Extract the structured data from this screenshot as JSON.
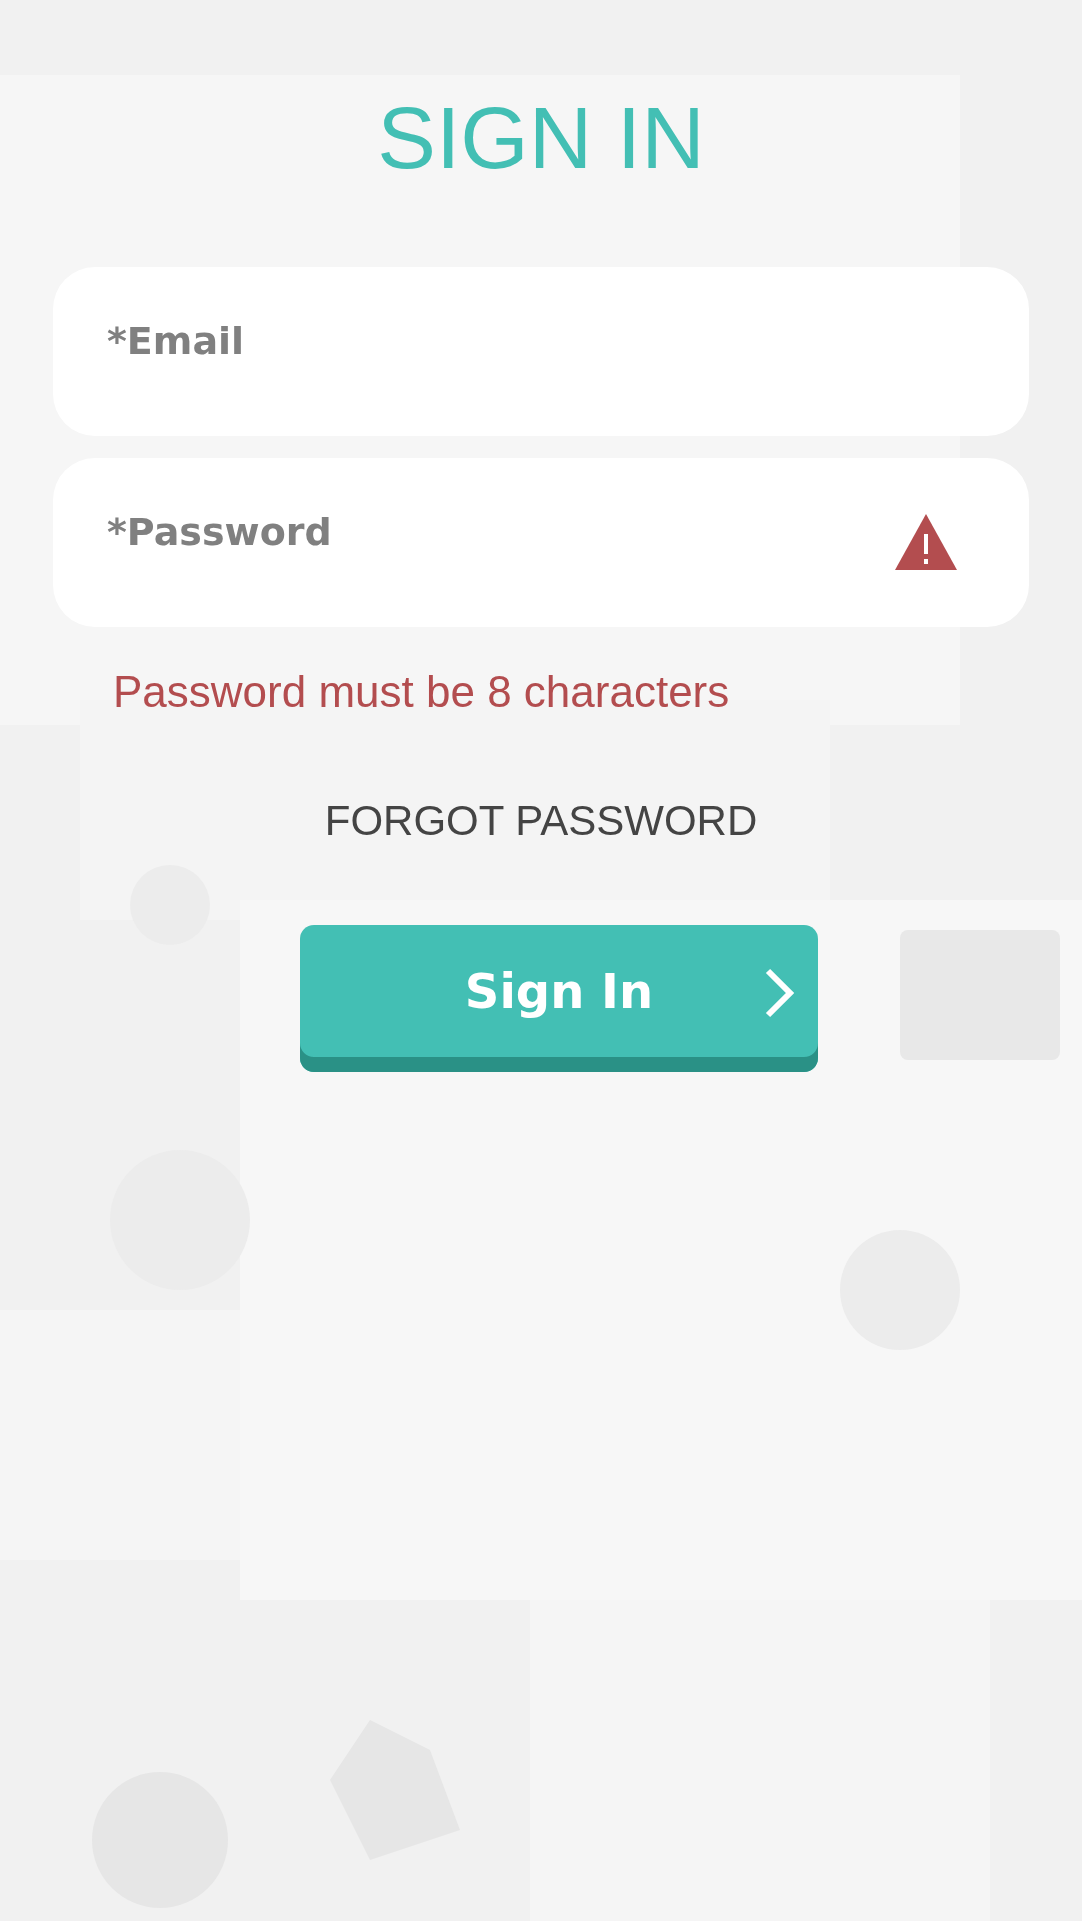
{
  "title": "SIGN IN",
  "fields": [
    {
      "placeholder": "*Email",
      "invalid": false
    },
    {
      "placeholder": "*Password",
      "invalid": true
    }
  ],
  "error_message": "Password must be 8 characters",
  "forgot_link": "FORGOT PASSWORD",
  "submit_button": "Sign In"
}
